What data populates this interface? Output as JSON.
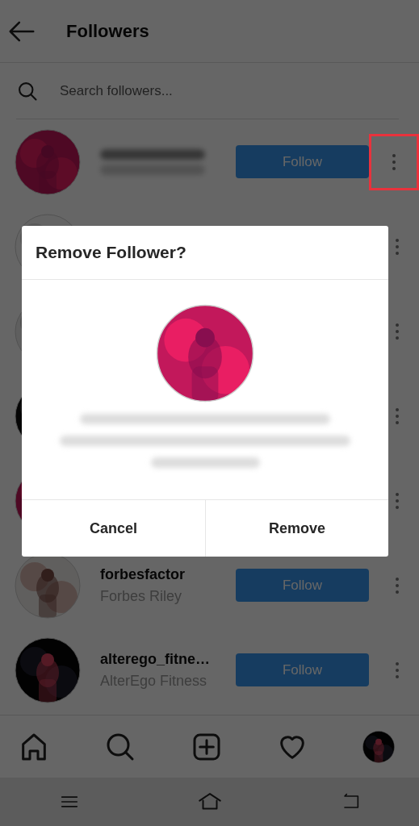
{
  "header": {
    "title": "Followers"
  },
  "search": {
    "placeholder": "Search followers..."
  },
  "rows": [
    {
      "kind": "redacted",
      "button": "Follow",
      "highlighted": true
    },
    {
      "kind": "covered",
      "highlighted": false
    },
    {
      "kind": "covered",
      "highlighted": false
    },
    {
      "kind": "covered",
      "highlighted": false
    },
    {
      "kind": "covered",
      "highlighted": false
    },
    {
      "kind": "user",
      "username": "forbesfactor",
      "name": "Forbes Riley",
      "button": "Follow",
      "highlighted": false
    },
    {
      "kind": "user",
      "username": "alterego_fitne…",
      "name": "AlterEgo Fitness",
      "button": "Follow",
      "highlighted": false
    }
  ],
  "dialog": {
    "title": "Remove Follower?",
    "actions": [
      "Cancel",
      "Remove"
    ]
  }
}
